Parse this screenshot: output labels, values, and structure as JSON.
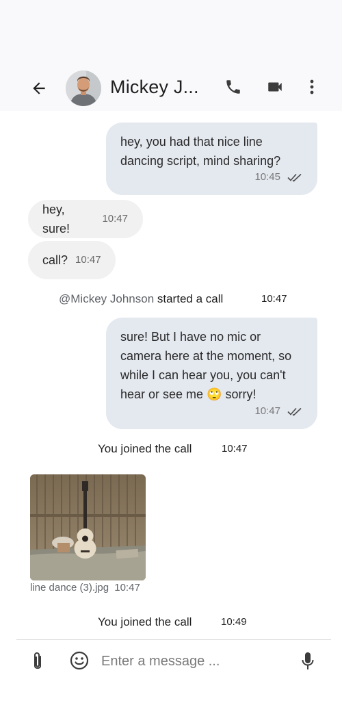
{
  "header": {
    "contact_name": "Mickey J...",
    "icons": {
      "back": "arrow-left-icon",
      "call": "phone-icon",
      "video": "video-camera-icon",
      "more": "more-vertical-icon"
    }
  },
  "messages": {
    "m1": {
      "text": "hey, you had that nice line\ndancing script, mind sharing?",
      "time": "10:45",
      "status": "read-double-check"
    },
    "m2": {
      "text": "hey, sure!",
      "time": "10:47"
    },
    "m3": {
      "text": "call?",
      "time": "10:47"
    },
    "call_started": {
      "who": "@Mickey Johnson",
      "action": " started a call",
      "time": "10:47"
    },
    "m4": {
      "text": "sure! But I have no mic or\ncamera here at the moment, so\nwhile I can hear you, you can't\nhear or see me ",
      "emoji": "🙄",
      "suffix": " sorry!",
      "time": "10:47",
      "status": "read-double-check"
    },
    "joined1": {
      "text": "You joined the call",
      "time": "10:47"
    },
    "image": {
      "filename": "line dance (3).jpg",
      "time": "10:47"
    },
    "joined2": {
      "text": "You joined the call",
      "time": "10:49"
    }
  },
  "composer": {
    "placeholder": "Enter a message ...",
    "icons": {
      "attach": "paperclip-icon",
      "emoji": "smiley-icon",
      "mic": "microphone-icon"
    }
  },
  "colors": {
    "outgoing_bubble": "#e4e8ef",
    "incoming_bubble": "#f1f1f1",
    "header_bg": "#f9f9fb"
  }
}
